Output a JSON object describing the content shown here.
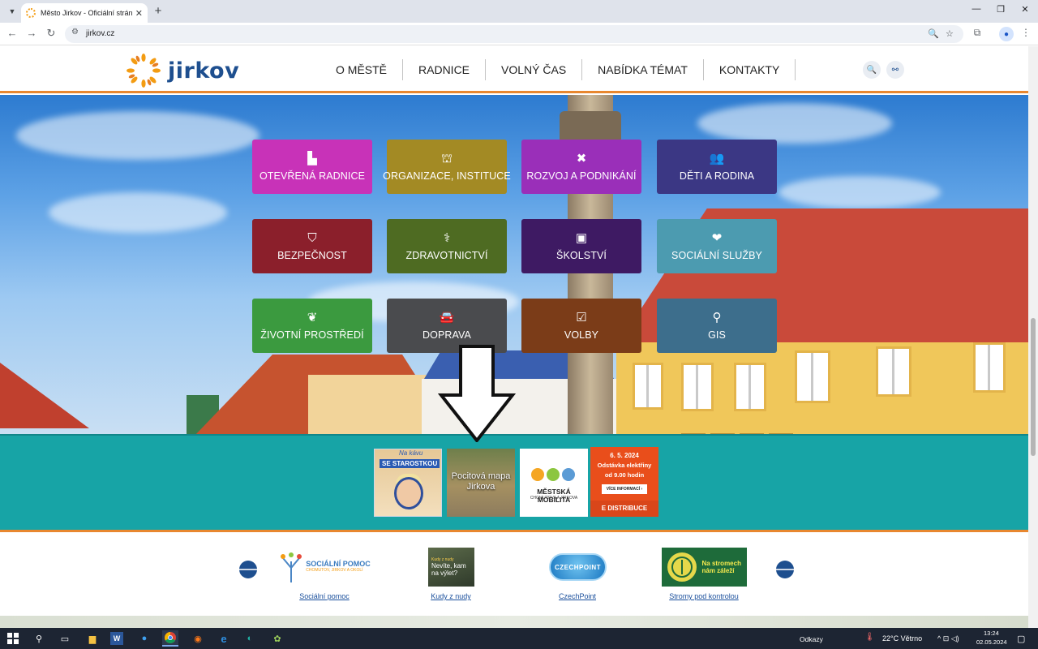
{
  "browser": {
    "tab_title": "Město Jirkov - Oficiální stránky",
    "tab_close": "✕",
    "new_tab": "+",
    "url": "jirkov.cz",
    "icons": [
      "chevron-down-icon",
      "back-icon",
      "forward-icon",
      "reload-icon",
      "site-info-icon",
      "zoom-icon",
      "star-icon",
      "extensions-icon",
      "profile-icon",
      "menu-icon"
    ],
    "window_controls": {
      "minimize": "—",
      "restore": "❐",
      "close": "✕"
    }
  },
  "site": {
    "logo_text": "jirkov",
    "logo_color": "#1e4f8f",
    "accent_color": "#e8872f",
    "nav": [
      "O MĚSTĚ",
      "RADNICE",
      "VOLNÝ ČAS",
      "NABÍDKA TÉMAT",
      "KONTAKTY"
    ],
    "header_icons": [
      "search-icon",
      "sitemap-icon"
    ]
  },
  "tiles": [
    {
      "label": "OTEVŘENÁ RADNICE",
      "icon": "building-icon",
      "glyph": "▙",
      "color": "#c832b8"
    },
    {
      "label": "ORGANIZACE, INSTITUCE",
      "icon": "institution-icon",
      "glyph": "⛫",
      "color": "#a38a24"
    },
    {
      "label": "ROZVOJ A PODNIKÁNÍ",
      "icon": "tools-icon",
      "glyph": "✖",
      "color": "#9a2fb9"
    },
    {
      "label": "DĚTI A RODINA",
      "icon": "users-icon",
      "glyph": "👥",
      "color": "#3b3784"
    },
    {
      "label": "BEZPEČNOST",
      "icon": "shield-icon",
      "glyph": "⛉",
      "color": "#8b1f2b"
    },
    {
      "label": "ZDRAVOTNICTVÍ",
      "icon": "doctor-icon",
      "glyph": "⚕",
      "color": "#4e6b22"
    },
    {
      "label": "ŠKOLSTVÍ",
      "icon": "teacher-icon",
      "glyph": "▣",
      "color": "#3e1a63"
    },
    {
      "label": "SOCIÁLNÍ SLUŽBY",
      "icon": "hand-holding-icon",
      "glyph": "❤",
      "color": "#4c9bb0"
    },
    {
      "label": "ŽIVOTNÍ PROSTŘEDÍ",
      "icon": "leaf-icon",
      "glyph": "❦",
      "color": "#3b9a3f"
    },
    {
      "label": "DOPRAVA",
      "icon": "car-icon",
      "glyph": "🚘",
      "color": "#4a4b4e"
    },
    {
      "label": "VOLBY",
      "icon": "vote-icon",
      "glyph": "☑",
      "color": "#7b3c18"
    },
    {
      "label": "GIS",
      "icon": "map-marker-icon",
      "glyph": "⚲",
      "color": "#3d6e8c"
    }
  ],
  "banners": {
    "starostka_title": "se starostkou",
    "starostka_pre": "Na kávu",
    "map_text": "Pocitová mapa Jirkova",
    "mobility_title": "MĚSTSKÁ MOBILITA",
    "mobility_sub": "CHOMUTOVA A JIRKOVA",
    "outage_date": "6. 5. 2024",
    "outage_line1": "Odstávka elektřiny",
    "outage_line2": "od 9.00 hodin",
    "outage_button": "VÍCE INFORMACÍ ›",
    "outage_footer": "Ε DISTRIBUCE"
  },
  "partners": [
    {
      "name": "SOCIÁLNÍ POMOC",
      "sub": "CHOMUTOV, JIRKOV A OKOLÍ",
      "link": "Sociální pomoc"
    },
    {
      "name": "Nevíte, kam na výlet?",
      "sub": "Kudy z nudy",
      "link": "Kudy z nudy"
    },
    {
      "name": "CZECHPOINT",
      "link": "CzechPoint"
    },
    {
      "name": "Na stromech nám záleží",
      "link": "Stromy pod kontrolou"
    }
  ],
  "carousel": {
    "prev": "🡐",
    "next": "🡒"
  },
  "taskbar": {
    "links_label": "Odkazy",
    "weather": "22°C  Větrno",
    "time": "13:24",
    "date": "02.05.2024",
    "apps": [
      "windows-start-icon",
      "search-icon",
      "task-view-icon",
      "file-explorer-icon",
      "word-icon",
      "app-icon",
      "chrome-icon",
      "firefox-icon",
      "edge-legacy-icon",
      "edge-icon",
      "app2-icon"
    ]
  }
}
